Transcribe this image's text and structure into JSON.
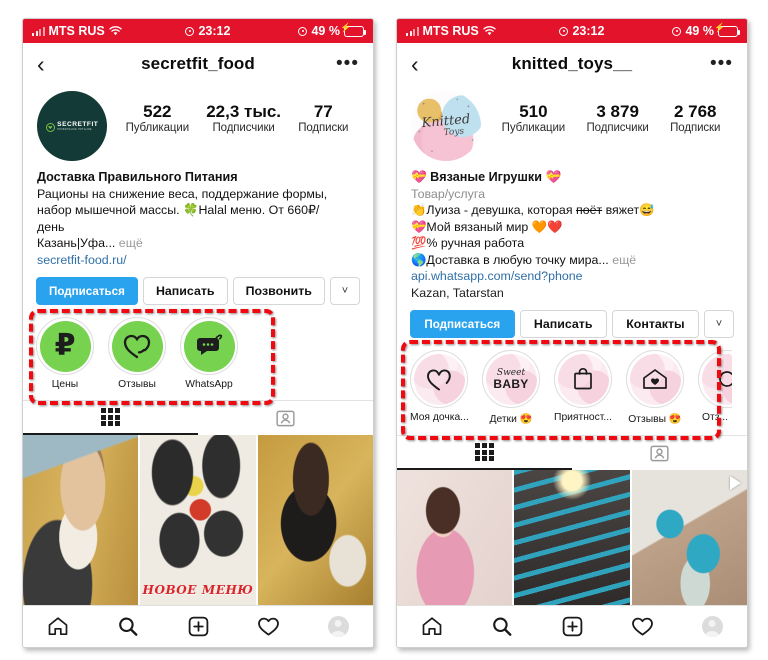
{
  "status_bar": {
    "carrier": "MTS RUS",
    "time": "23:12",
    "battery": "49 %"
  },
  "colors": {
    "status_bar_bg": "#e3132c",
    "primary_button": "#2aa3ef",
    "link": "#2f6fa8",
    "annotation": "#ef0a12",
    "highlight_green": "#76d24f",
    "highlight_pink": "#fbeaf0"
  },
  "left_phone": {
    "header": {
      "title": "secretfit_food",
      "back": "‹",
      "more": "•••"
    },
    "stats": [
      {
        "num": "522",
        "label": "Публикации"
      },
      {
        "num": "22,3 тыс.",
        "label": "Подписчики"
      },
      {
        "num": "77",
        "label": "Подписки"
      }
    ],
    "avatar_logo": {
      "brand": "SECRETFIT",
      "tagline": "ПРАВИЛЬНОЕ ПИТАНИЕ"
    },
    "bio": {
      "title": "Доставка Правильного Питания",
      "line1": "Рационы на снижение веса, поддержание формы,",
      "line2": "набор мышечной массы. 🍀Halal меню. От 660₽/",
      "line3": "день",
      "line4": "Казань|Уфа...",
      "more": "ещё",
      "link": "secretfit-food.ru/"
    },
    "actions": {
      "follow": "Подписаться",
      "message": "Написать",
      "call": "Позвонить",
      "chevron": "˅"
    },
    "highlights": [
      {
        "label": "Цены",
        "icon": "ruble-icon"
      },
      {
        "label": "Отзывы",
        "icon": "heart-icon"
      },
      {
        "label": "WhatsApp",
        "icon": "whatsapp-icon"
      }
    ],
    "tabs": [
      {
        "name": "grid-tab",
        "active": true
      },
      {
        "name": "tagged-tab",
        "active": false
      }
    ],
    "photos": [
      {
        "name": "photo-woman-eating"
      },
      {
        "name": "photo-meal-boxes",
        "caption": "НОВОЕ МЕНЮ"
      },
      {
        "name": "photo-woman-with-meal"
      }
    ]
  },
  "right_phone": {
    "header": {
      "title": "knitted_toys__",
      "back": "‹",
      "more": "•••"
    },
    "stats": [
      {
        "num": "510",
        "label": "Публикации"
      },
      {
        "num": "3 879",
        "label": "Подписчики"
      },
      {
        "num": "2 768",
        "label": "Подписки"
      }
    ],
    "avatar_logo": {
      "line1": "Knitted",
      "line2": "Toys"
    },
    "bio": {
      "title": "💝 Вязаные  Игрушки 💝",
      "category": "Товар/услуга",
      "line1_prefix": "👏Луиза - девушка, которая ",
      "line1_strike": "поёт",
      "line1_suffix": " вяжет😅",
      "line2": "💝Мой вязаный мир 🧡❤️",
      "line3": "💯% ручная работа",
      "line4": "🌎Доставка в любую точку мира...",
      "more": "ещё",
      "link": "api.whatsapp.com/send?phone",
      "address": "Kazan, Tatarstan"
    },
    "actions": {
      "follow": "Подписаться",
      "message": "Написать",
      "contacts": "Контакты",
      "chevron": "˅"
    },
    "highlights": [
      {
        "label": "Моя дочка...",
        "icon": "heart-outline-icon"
      },
      {
        "label": "Детки 😍",
        "icon": "sweet-baby-icon",
        "icon_text_1": "Sweet",
        "icon_text_2": "BABY"
      },
      {
        "label": "Приятност...",
        "icon": "shopping-bag-icon"
      },
      {
        "label": "Отзывы 😍",
        "icon": "house-heart-icon"
      },
      {
        "label": "Отз...",
        "icon": "partial-icon"
      }
    ],
    "tabs": [
      {
        "name": "grid-tab",
        "active": true
      },
      {
        "name": "tagged-tab",
        "active": false
      }
    ],
    "photos": [
      {
        "name": "photo-woman-pink-dress"
      },
      {
        "name": "photo-blue-ribbon-tree"
      },
      {
        "name": "photo-blue-bow-gift",
        "has_video": true
      }
    ]
  },
  "bottom_nav": [
    {
      "name": "home-icon"
    },
    {
      "name": "search-icon"
    },
    {
      "name": "add-post-icon"
    },
    {
      "name": "activity-heart-icon"
    },
    {
      "name": "profile-avatar-icon"
    }
  ]
}
